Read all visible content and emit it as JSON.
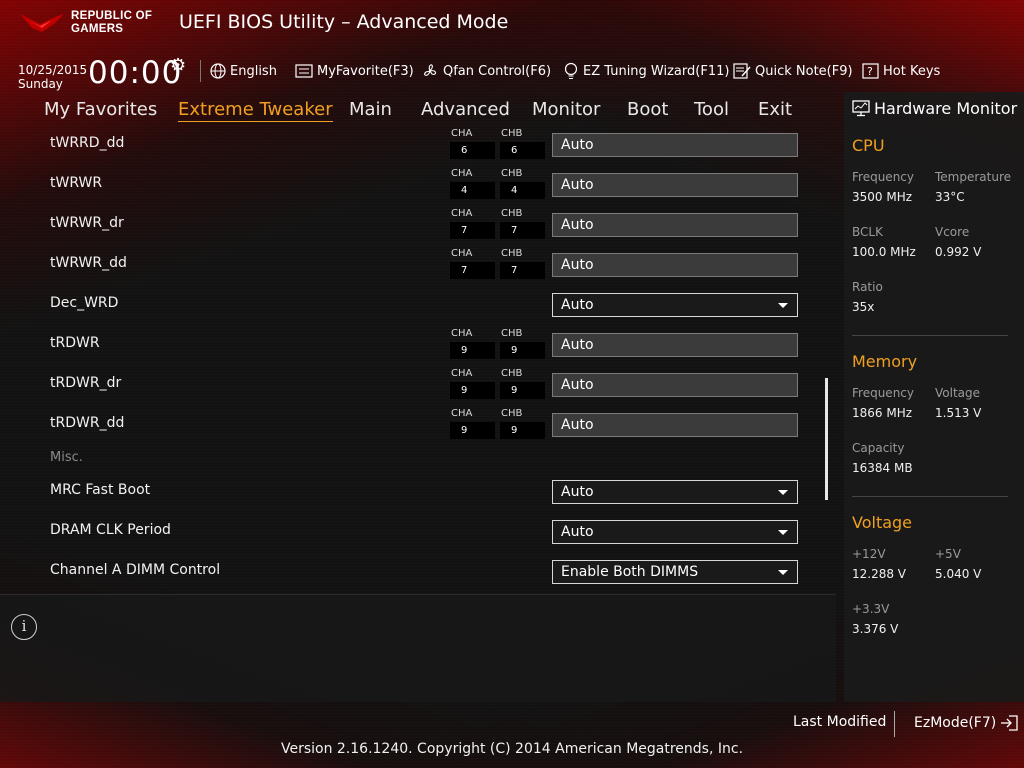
{
  "header": {
    "brand_line1": "REPUBLIC OF",
    "brand_line2": "GAMERS",
    "title": "UEFI BIOS Utility – Advanced Mode",
    "date": "10/25/2015",
    "day": "Sunday",
    "time": "00:00"
  },
  "toolbar": {
    "language": "English",
    "myfavorite": "MyFavorite(F3)",
    "qfan": "Qfan Control(F6)",
    "ez_tuning": "EZ Tuning Wizard(F11)",
    "quick_note": "Quick Note(F9)",
    "hot_keys": "Hot Keys"
  },
  "tabs": [
    "My Favorites",
    "Extreme Tweaker",
    "Main",
    "Advanced",
    "Monitor",
    "Boot",
    "Tool",
    "Exit"
  ],
  "active_tab": "Extreme Tweaker",
  "channel_labels": {
    "a": "CHA",
    "b": "CHB"
  },
  "settings": {
    "rows": [
      {
        "label": "tWRRD_dd",
        "cha": "6",
        "chb": "6",
        "value": "Auto"
      },
      {
        "label": "tWRWR",
        "cha": "4",
        "chb": "4",
        "value": "Auto"
      },
      {
        "label": "tWRWR_dr",
        "cha": "7",
        "chb": "7",
        "value": "Auto"
      },
      {
        "label": "tWRWR_dd",
        "cha": "7",
        "chb": "7",
        "value": "Auto"
      },
      {
        "label": "Dec_WRD",
        "value": "Auto"
      },
      {
        "label": "tRDWR",
        "cha": "9",
        "chb": "9",
        "value": "Auto"
      },
      {
        "label": "tRDWR_dr",
        "cha": "9",
        "chb": "9",
        "value": "Auto"
      },
      {
        "label": "tRDWR_dd",
        "cha": "9",
        "chb": "9",
        "value": "Auto"
      }
    ],
    "section": "Misc.",
    "misc_rows": [
      {
        "label": "MRC Fast Boot",
        "value": "Auto"
      },
      {
        "label": "DRAM CLK Period",
        "value": "Auto"
      },
      {
        "label": "Channel A DIMM Control",
        "value": "Enable Both DIMMS"
      }
    ]
  },
  "hardware_monitor": {
    "title": "Hardware Monitor",
    "cpu": {
      "heading": "CPU",
      "frequency_label": "Frequency",
      "frequency": "3500 MHz",
      "temperature_label": "Temperature",
      "temperature": "33°C",
      "bclk_label": "BCLK",
      "bclk": "100.0 MHz",
      "vcore_label": "Vcore",
      "vcore": "0.992 V",
      "ratio_label": "Ratio",
      "ratio": "35x"
    },
    "memory": {
      "heading": "Memory",
      "frequency_label": "Frequency",
      "frequency": "1866 MHz",
      "voltage_label": "Voltage",
      "voltage": "1.513 V",
      "capacity_label": "Capacity",
      "capacity": "16384 MB"
    },
    "voltage": {
      "heading": "Voltage",
      "v12_label": "+12V",
      "v12": "12.288 V",
      "v5_label": "+5V",
      "v5": "5.040 V",
      "v33_label": "+3.3V",
      "v33": "3.376 V"
    }
  },
  "footer": {
    "last_modified": "Last Modified",
    "ezmode": "EzMode(F7)",
    "copyright": "Version 2.16.1240. Copyright (C) 2014 American Megatrends, Inc."
  },
  "colors": {
    "accent": "#f0a020",
    "brand_red": "#a00000"
  }
}
